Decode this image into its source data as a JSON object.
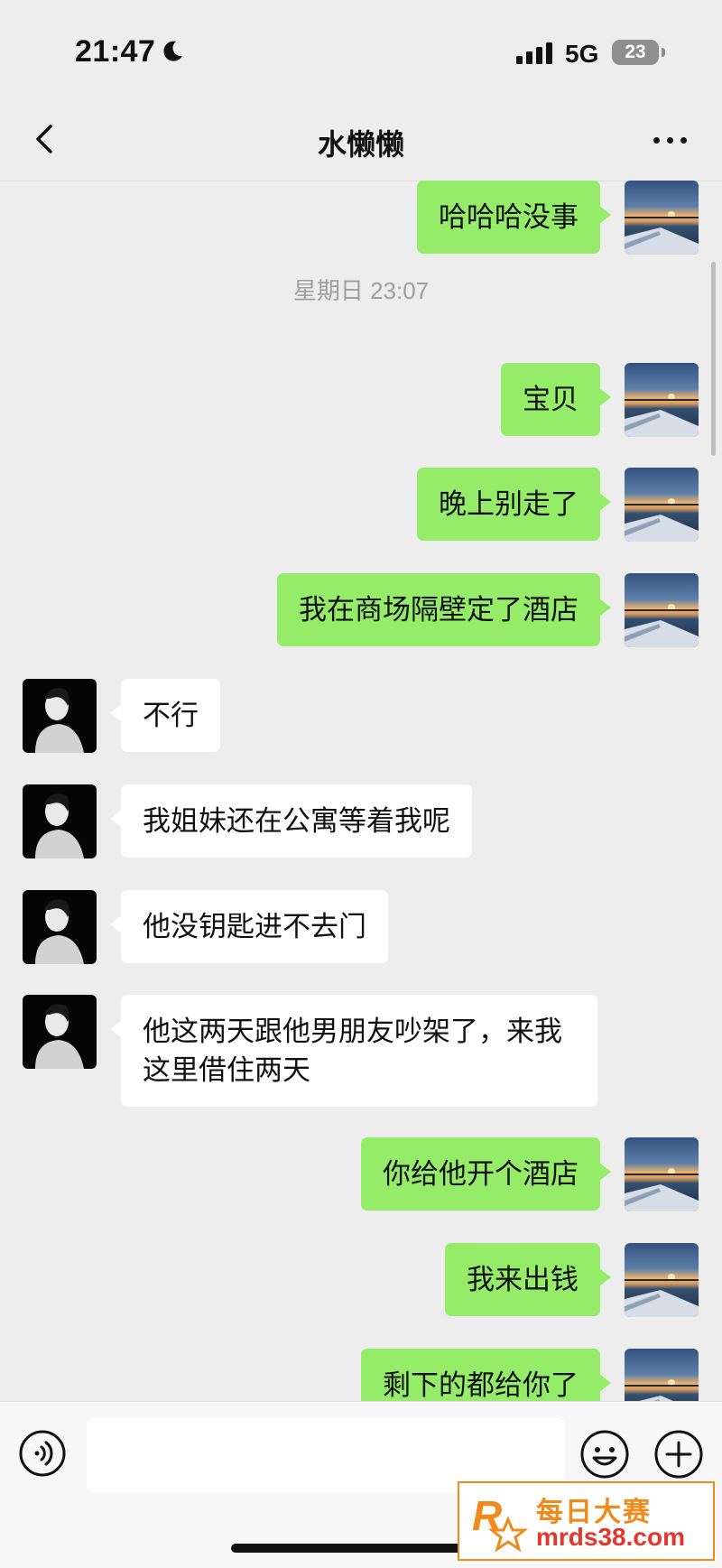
{
  "status_bar": {
    "time": "21:47",
    "network": "5G",
    "battery": "23"
  },
  "nav": {
    "title": "水懒懒"
  },
  "messages": [
    {
      "side": "me",
      "text": "哈哈哈没事"
    },
    {
      "side": "time",
      "text": "星期日 23:07"
    },
    {
      "side": "me",
      "text": "宝贝"
    },
    {
      "side": "me",
      "text": "晚上别走了"
    },
    {
      "side": "me",
      "text": "我在商场隔壁定了酒店"
    },
    {
      "side": "them",
      "text": "不行"
    },
    {
      "side": "them",
      "text": "我姐妹还在公寓等着我呢"
    },
    {
      "side": "them",
      "text": "他没钥匙进不去门"
    },
    {
      "side": "them",
      "text": "他这两天跟他男朋友吵架了，来我这里借住两天"
    },
    {
      "side": "me",
      "text": "你给他开个酒店"
    },
    {
      "side": "me",
      "text": "我来出钱"
    },
    {
      "side": "me",
      "text": "剩下的都给你了"
    }
  ],
  "input": {
    "placeholder": ""
  },
  "watermark": {
    "brand_cn": "每日大赛",
    "url": "mrds38.com",
    "logo_letter": "R"
  },
  "colors": {
    "my_bubble": "#95ec69",
    "their_bubble": "#ffffff",
    "background": "#ededed"
  }
}
